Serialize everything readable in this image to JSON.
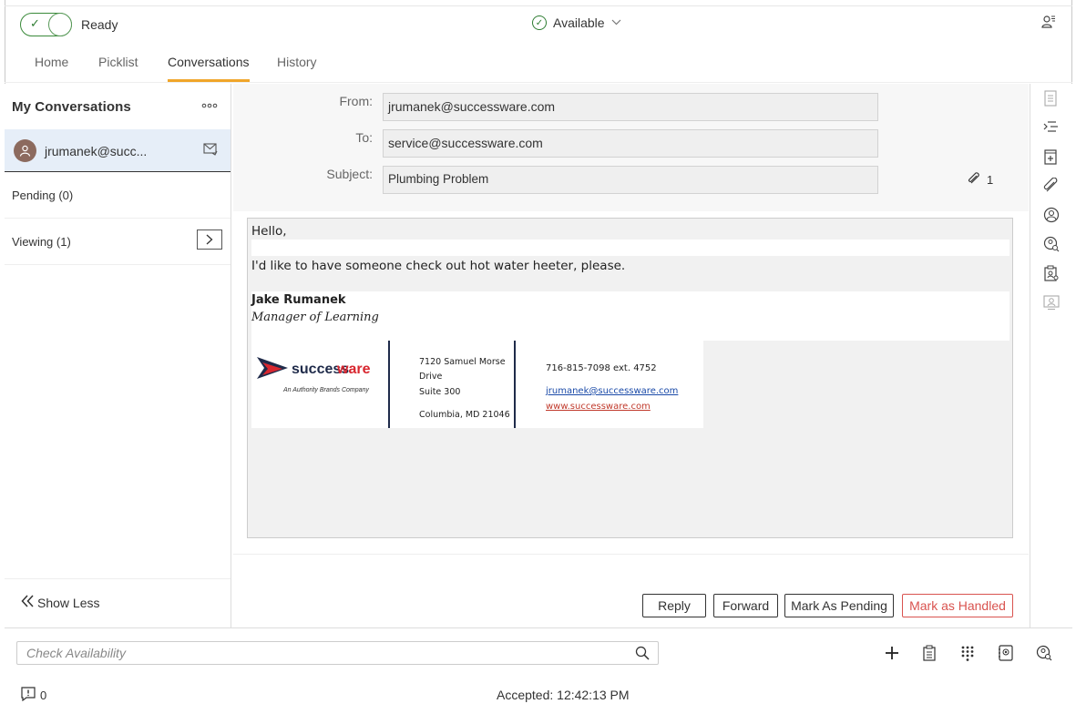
{
  "topbar": {
    "status_label": "Ready",
    "availability": "Available"
  },
  "tabs": [
    {
      "label": "Home"
    },
    {
      "label": "Picklist"
    },
    {
      "label": "Conversations"
    },
    {
      "label": "History"
    }
  ],
  "sidebar": {
    "title": "My Conversations",
    "conversation": {
      "address": "jrumanek@succ..."
    },
    "pending": "Pending (0)",
    "viewing": "Viewing (1)",
    "show_less": "Show Less"
  },
  "email": {
    "from_label": "From:",
    "from": "jrumanek@successware.com",
    "to_label": "To:",
    "to": "service@successware.com",
    "subject_label": "Subject:",
    "subject": "Plumbing Problem",
    "attachment_count": "1",
    "greeting": "Hello,",
    "body": "I'd like to have someone check out hot water heeter, please.",
    "signature": {
      "name": "Jake Rumanek",
      "title": "Manager of Learning",
      "logo_text_a": "success",
      "logo_text_b": "ware",
      "logo_tagline": "An Authority Brands Company",
      "address_line1": "7120 Samuel Morse",
      "address_line2": "Drive",
      "address_line3": "Suite 300",
      "address_line4": "Columbia, MD 21046",
      "phone": "716-815-7098 ext. 4752",
      "email": "jrumanek@successware.com",
      "website": "www.successware.com"
    }
  },
  "actions": {
    "reply": "Reply",
    "forward": "Forward",
    "mark_pending": "Mark As Pending",
    "mark_handled": "Mark as Handled"
  },
  "bottom": {
    "search_placeholder": "Check Availability",
    "alert_count": "0",
    "accepted": "Accepted: 12:42:13 PM"
  },
  "colors": {
    "tab_underline": "#f0a52a",
    "available_green": "#2e7d32",
    "handled_red": "#d9534f",
    "selected_row": "#e6eef8",
    "logo_navy": "#1f2b4a",
    "logo_red": "#d8272f"
  },
  "icons": {
    "rail": [
      "notes-icon",
      "list-indent-icon",
      "calendar-add-icon",
      "paperclip-icon",
      "contact-icon",
      "contact-search-icon",
      "clipboard-contact-icon",
      "contact-card-icon"
    ],
    "bottom": [
      "plus-icon",
      "clipboard-icon",
      "dialpad-icon",
      "address-book-icon",
      "contact-search-icon"
    ]
  }
}
